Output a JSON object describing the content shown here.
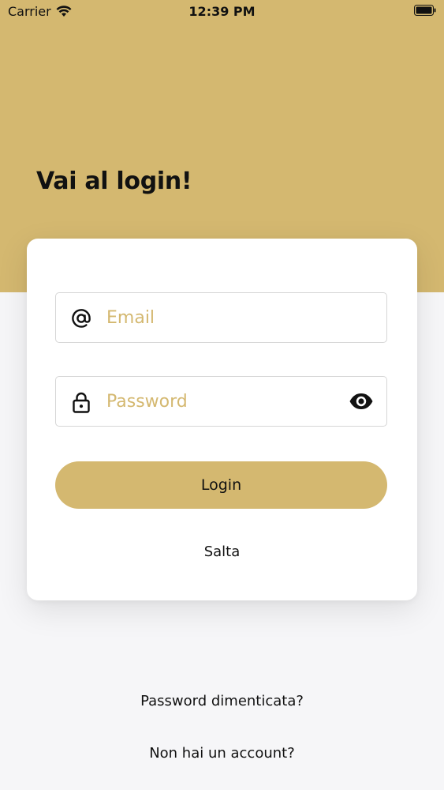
{
  "status_bar": {
    "carrier": "Carrier",
    "time": "12:39 PM"
  },
  "header": {
    "title": "Vai al login!"
  },
  "form": {
    "email_placeholder": "Email",
    "password_placeholder": "Password",
    "login_label": "Login",
    "skip_label": "Salta"
  },
  "links": {
    "forgot_password": "Password dimenticata?",
    "no_account": "Non hai un account?"
  },
  "icons": {
    "email": "at-sign-icon",
    "password": "lock-icon",
    "visibility": "eye-icon"
  },
  "colors": {
    "accent": "#d4b870",
    "background": "#f6f6f8",
    "card": "#ffffff"
  }
}
